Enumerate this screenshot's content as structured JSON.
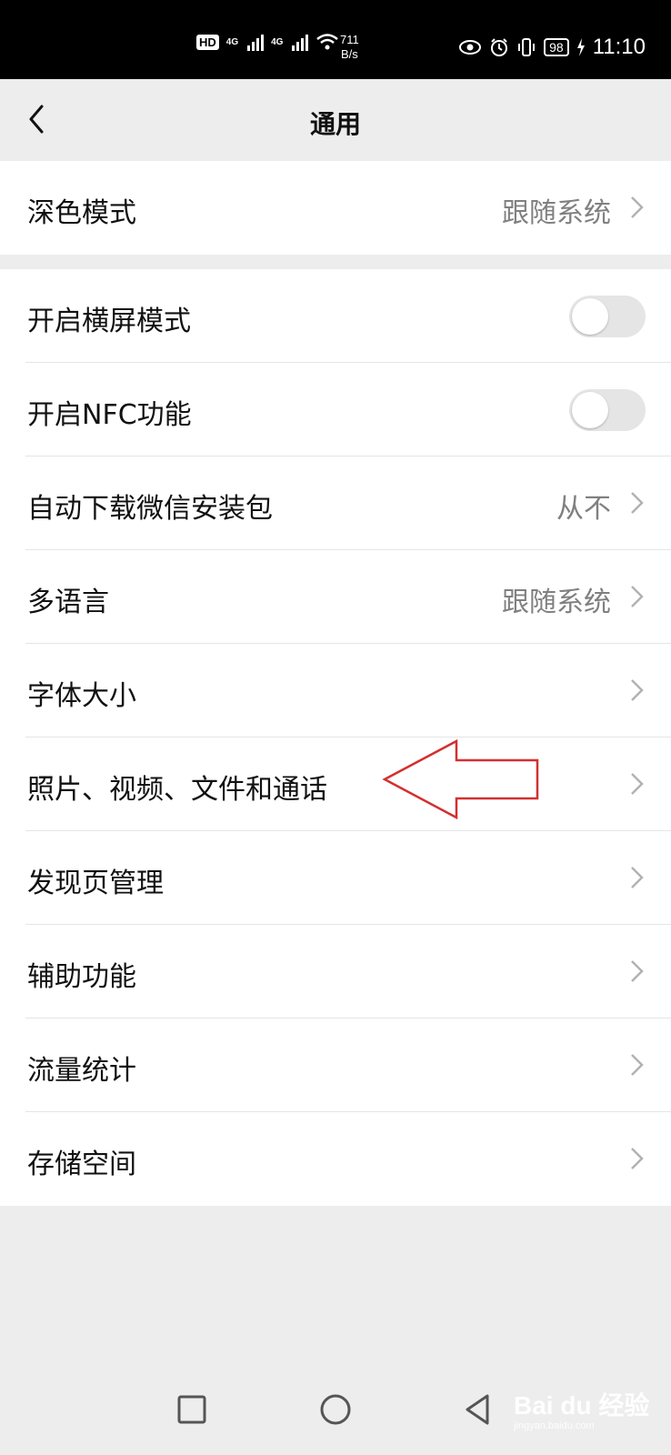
{
  "status_bar": {
    "hd_badge": "HD",
    "network_1": "4G",
    "network_2": "4G",
    "speed_value": "711",
    "speed_unit": "B/s",
    "battery": "98",
    "time": "11:10"
  },
  "nav": {
    "title": "通用"
  },
  "section_1": {
    "rows": [
      {
        "label": "深色模式",
        "value": "跟随系统"
      }
    ]
  },
  "section_2": {
    "rows": [
      {
        "label": "开启横屏模式",
        "type": "toggle",
        "on": false
      },
      {
        "label": "开启NFC功能",
        "type": "toggle",
        "on": false
      },
      {
        "label": "自动下载微信安装包",
        "value": "从不"
      },
      {
        "label": "多语言",
        "value": "跟随系统"
      },
      {
        "label": "字体大小",
        "value": ""
      },
      {
        "label": "照片、视频、文件和通话",
        "value": ""
      },
      {
        "label": "发现页管理",
        "value": ""
      },
      {
        "label": "辅助功能",
        "value": ""
      },
      {
        "label": "流量统计",
        "value": ""
      },
      {
        "label": "存储空间",
        "value": ""
      }
    ]
  },
  "annotation": {
    "color": "#d32f2f"
  },
  "watermark": {
    "brand": "Bai du 经验",
    "url": "jingyan.baidu.com"
  },
  "colors": {
    "background": "#ededed",
    "cell": "#ffffff",
    "secondary_text": "#808080",
    "toggle_off": "#e5e5e5"
  }
}
